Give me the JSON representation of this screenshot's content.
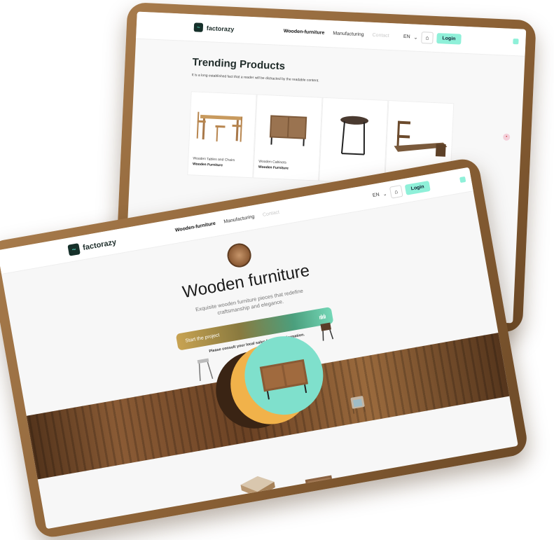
{
  "back_screen": {
    "logo_text": "factorazy",
    "nav": {
      "items": [
        "Wooden-furniture",
        "Manufacturing",
        "Contact"
      ]
    },
    "lang": "EN",
    "login_label": "Login",
    "section_title": "Trending Products",
    "section_subtitle": "It is a long established fact that a reader will be distracted by the readable content.",
    "cards": [
      {
        "name": "Wooden Tables and Chairs",
        "category": "Wooden Furniture"
      },
      {
        "name": "Wooden Cabinets",
        "category": "Wooden Furniture"
      },
      {
        "name": "",
        "category": ""
      },
      {
        "name": "",
        "category": ""
      }
    ]
  },
  "front_screen": {
    "logo_text": "factorazy",
    "nav": {
      "items": [
        "Wooden-furniture",
        "Manufacturing",
        "Contact"
      ]
    },
    "lang": "EN",
    "login_label": "Login",
    "hero_title": "Wooden furniture",
    "hero_description_line1": "Exquisite wooden furniture pieces that redefine",
    "hero_description_line2": "craftsmanship and elegance.",
    "cta_label": "Start the project",
    "note": "Please consult your local sales for more information."
  },
  "colors": {
    "accent": "#8ff0d9",
    "wood": "#8a5b35",
    "cta_start": "#c8a352",
    "cta_end": "#74d7b7",
    "dark": "#16302a"
  }
}
